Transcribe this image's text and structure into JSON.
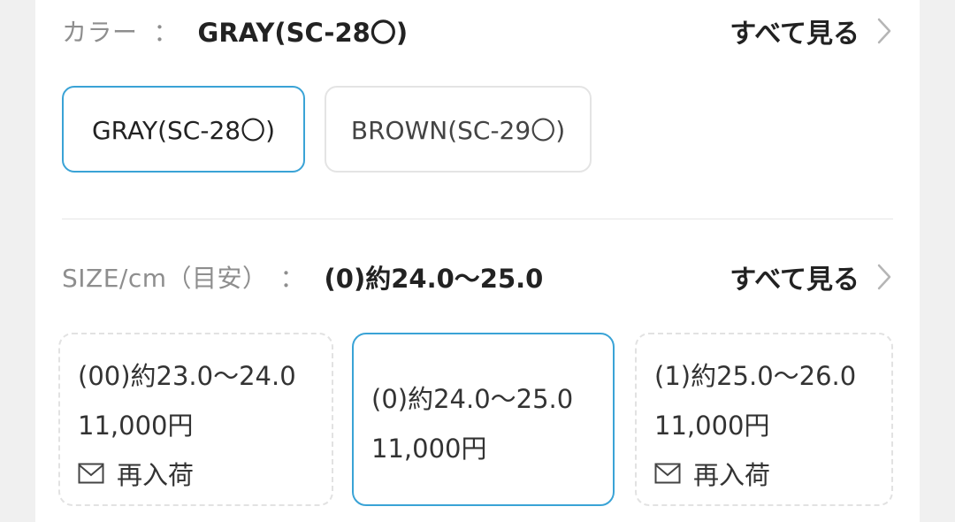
{
  "color_section": {
    "label": "カラー",
    "colon": "：",
    "selected_value": "GRAY(SC-28〇)",
    "see_all": "すべて見る",
    "options": [
      {
        "label": "GRAY(SC-28〇)",
        "selected": true
      },
      {
        "label": "BROWN(SC-29〇)",
        "selected": false
      }
    ]
  },
  "size_section": {
    "label": "SIZE/cm（目安）",
    "colon": "：",
    "selected_value": "(0)約24.0〜25.0",
    "see_all": "すべて見る",
    "options": [
      {
        "size": "(00)約23.0〜24.0",
        "price": "11,000円",
        "restock": "再入荷",
        "selected": false
      },
      {
        "size": "(0)約24.0〜25.0",
        "price": "11,000円",
        "restock": "",
        "selected": true
      },
      {
        "size": "(1)約25.0〜26.0",
        "price": "11,000円",
        "restock": "再入荷",
        "selected": false
      }
    ]
  },
  "colors": {
    "accent": "#3aa3d6",
    "label_gray": "#8e8e8e",
    "text": "#222222"
  }
}
